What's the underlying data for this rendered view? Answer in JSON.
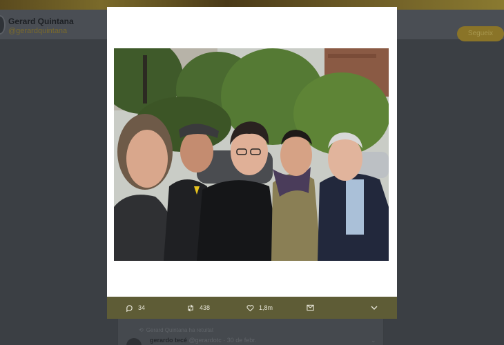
{
  "profile": {
    "name": "Gerard Quintana",
    "handle": "@gerardquintana",
    "follow_label": "Segueix"
  },
  "modal": {
    "photo_alt": "",
    "actions": {
      "replies": "34",
      "retweets": "438",
      "likes": "1,8m"
    }
  },
  "timeline": {
    "retweet_note": "Gerard Quintana ha retuitat",
    "author_name": "gerardo tecé",
    "author_meta": "@gerardotc · 30 de febr."
  },
  "colors": {
    "action_bar": "#5e5c36",
    "overlay": "#3b3f44"
  }
}
